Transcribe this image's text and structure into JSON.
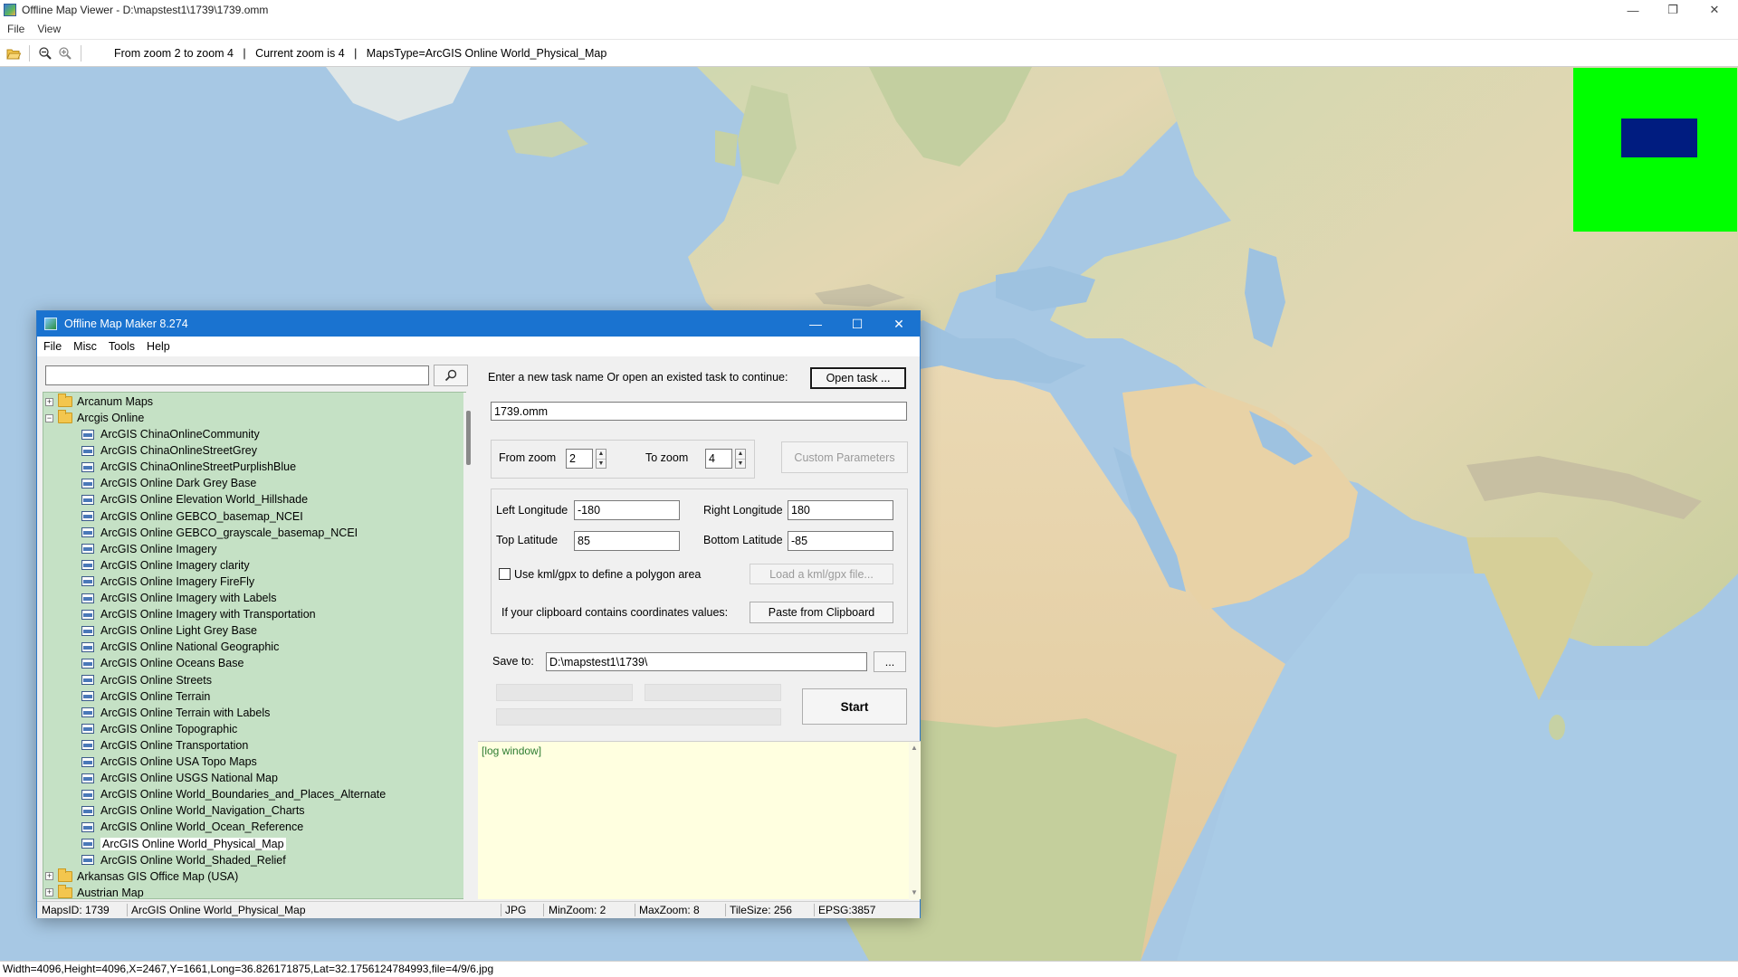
{
  "viewer": {
    "title": "Offline Map Viewer - D:\\mapstest1\\1739\\1739.omm",
    "window_controls": {
      "minimize": "—",
      "maximize": "❐",
      "close": "✕"
    },
    "menu": [
      "File",
      "View"
    ],
    "toolbar_info": "From zoom 2 to zoom 4   |   Current zoom is 4   |   MapsType=ArcGIS Online World_Physical_Map",
    "status": "Width=4096,Height=4096,X=2467,Y=1661,Long=36.826171875,Lat=32.1756124784993,file=4/9/6.jpg"
  },
  "overview_colors": {
    "background": "#00ff00",
    "viewport": "#001c80"
  },
  "dialog": {
    "title": "Offline Map Maker 8.274",
    "window_controls": {
      "minimize": "—",
      "maximize": "☐",
      "close": "✕"
    },
    "menu": [
      "File",
      "Misc",
      "Tools",
      "Help"
    ],
    "search": {
      "value": "",
      "icon": "search-icon"
    },
    "tree": {
      "top_folders_before": [
        {
          "label": "Arcanum Maps",
          "expanded": false
        }
      ],
      "open_folder": {
        "label": "Arcgis Online",
        "expanded": true
      },
      "items": [
        "ArcGIS ChinaOnlineCommunity",
        "ArcGIS ChinaOnlineStreetGrey",
        "ArcGIS ChinaOnlineStreetPurplishBlue",
        "ArcGIS Online Dark Grey Base",
        "ArcGIS Online Elevation World_Hillshade",
        "ArcGIS Online GEBCO_basemap_NCEI",
        "ArcGIS Online GEBCO_grayscale_basemap_NCEI",
        "ArcGIS Online Imagery",
        "ArcGIS Online Imagery clarity",
        "ArcGIS Online Imagery FireFly",
        "ArcGIS Online Imagery with Labels",
        "ArcGIS Online Imagery with Transportation",
        "ArcGIS Online Light Grey Base",
        "ArcGIS Online National Geographic",
        "ArcGIS Online Oceans Base",
        "ArcGIS Online Streets",
        "ArcGIS Online Terrain",
        "ArcGIS Online Terrain with Labels",
        "ArcGIS Online Topographic",
        "ArcGIS Online Transportation",
        "ArcGIS Online USA Topo Maps",
        "ArcGIS Online USGS National Map",
        "ArcGIS Online World_Boundaries_and_Places_Alternate",
        "ArcGIS Online World_Navigation_Charts",
        "ArcGIS Online World_Ocean_Reference",
        "ArcGIS Online World_Physical_Map",
        "ArcGIS Online World_Shaded_Relief"
      ],
      "selected_item": "ArcGIS Online World_Physical_Map",
      "top_folders_after": [
        {
          "label": "Arkansas GIS Office Map (USA)",
          "expanded": false
        },
        {
          "label": "Austrian Map",
          "expanded": false
        }
      ]
    },
    "task": {
      "prompt": "Enter a new task name Or open an existed task to continue:",
      "open_button": "Open task ...",
      "task_name": "1739.omm"
    },
    "zoom": {
      "from_label": "From zoom",
      "from_value": "2",
      "to_label": "To zoom",
      "to_value": "4",
      "custom_button": "Custom Parameters"
    },
    "bounds": {
      "left_label": "Left Longitude",
      "left_value": "-180",
      "right_label": "Right Longitude",
      "right_value": "180",
      "top_label": "Top Latitude",
      "top_value": "85",
      "bottom_label": "Bottom Latitude",
      "bottom_value": "-85",
      "kml_checkbox": "Use kml/gpx to define a polygon area",
      "kml_checked": false,
      "load_kml_button": "Load a kml/gpx file...",
      "clipboard_label": "If your clipboard contains coordinates values:",
      "paste_button": "Paste from Clipboard"
    },
    "save": {
      "label": "Save to:",
      "path": "D:\\mapstest1\\1739\\",
      "browse_button": "...",
      "start_button": "Start"
    },
    "log": {
      "text": "[log window]"
    },
    "status": {
      "maps_id": "MapsID: 1739",
      "map_name": "ArcGIS Online World_Physical_Map",
      "format": "JPG",
      "min_zoom": "MinZoom: 2",
      "max_zoom": "MaxZoom: 8",
      "tile_size": "TileSize: 256",
      "epsg": "EPSG:3857"
    }
  }
}
